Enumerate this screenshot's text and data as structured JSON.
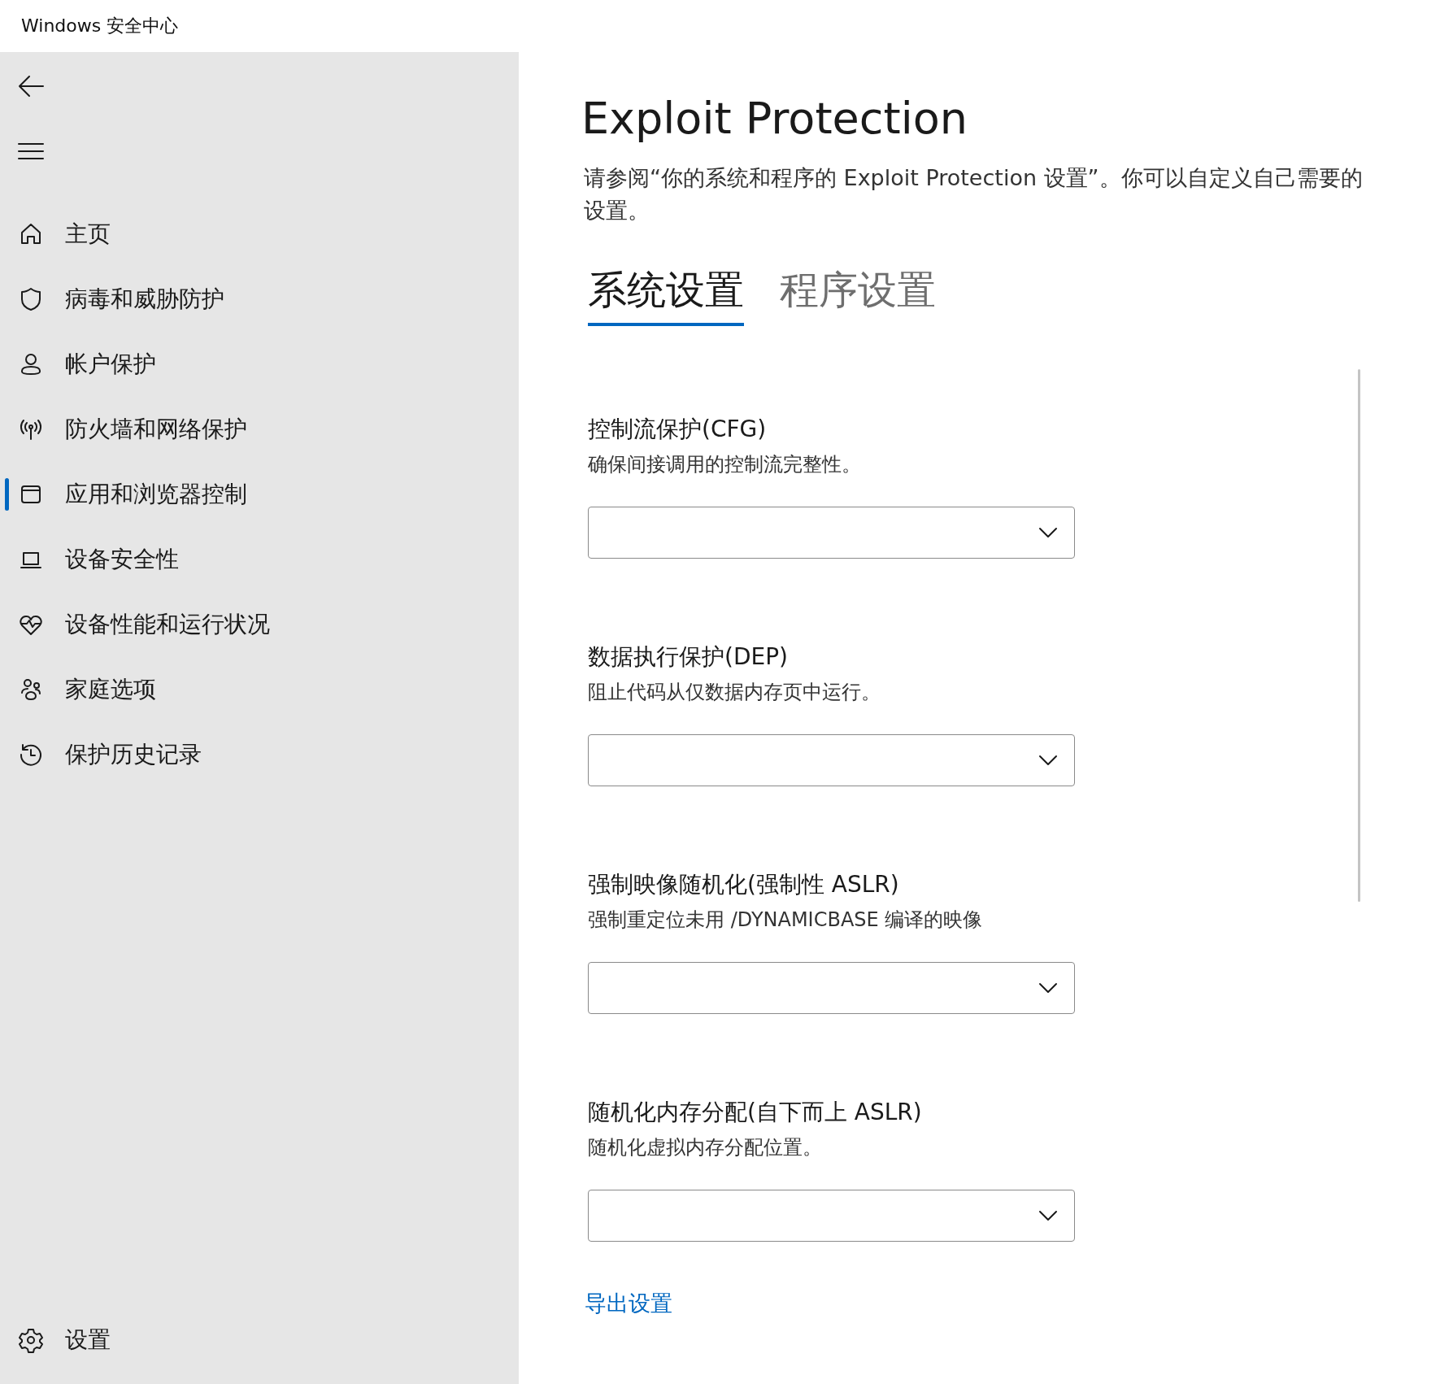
{
  "window": {
    "title": "Windows 安全中心"
  },
  "sidebar": {
    "items": [
      {
        "label": "主页",
        "selected": false
      },
      {
        "label": "病毒和威胁防护",
        "selected": false
      },
      {
        "label": "帐户保护",
        "selected": false
      },
      {
        "label": "防火墙和网络保护",
        "selected": false
      },
      {
        "label": "应用和浏览器控制",
        "selected": true
      },
      {
        "label": "设备安全性",
        "selected": false
      },
      {
        "label": "设备性能和运行状况",
        "selected": false
      },
      {
        "label": "家庭选项",
        "selected": false
      },
      {
        "label": "保护历史记录",
        "selected": false
      }
    ],
    "settings": {
      "label": "设置"
    }
  },
  "page": {
    "title": "Exploit Protection",
    "description": "请参阅“你的系统和程序的 Exploit Protection 设置”。你可以自定义自己需要的设置。",
    "tabs": [
      {
        "label": "系统设置",
        "selected": true
      },
      {
        "label": "程序设置",
        "selected": false
      }
    ],
    "sections": [
      {
        "title": "控制流保护(CFG)",
        "description": "确保间接调用的控制流完整性。"
      },
      {
        "title": "数据执行保护(DEP)",
        "description": "阻止代码从仅数据内存页中运行。"
      },
      {
        "title": "强制映像随机化(强制性 ASLR)",
        "description": "强制重定位未用 /DYNAMICBASE 编译的映像"
      },
      {
        "title": "随机化内存分配(自下而上 ASLR)",
        "description": "随机化虚拟内存分配位置。"
      }
    ],
    "export_link": "导出设置"
  }
}
